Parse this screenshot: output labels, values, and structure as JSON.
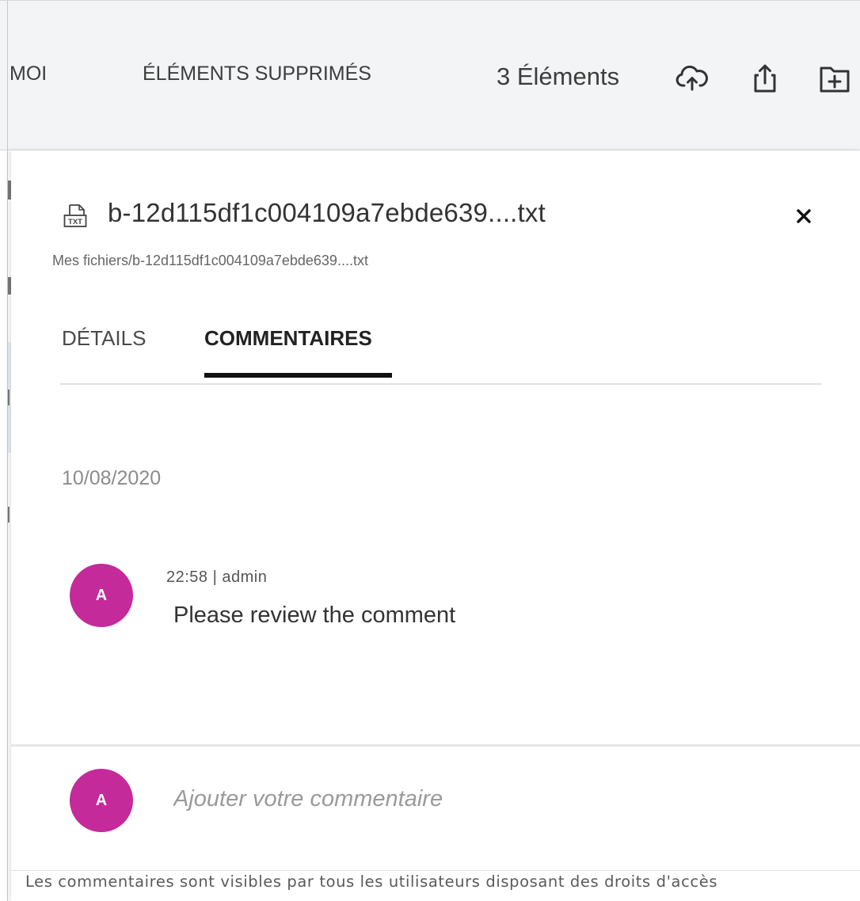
{
  "toolbar": {
    "tab_moi": "MOI",
    "tab_deleted": "ÉLÉMENTS SUPPRIMÉS",
    "item_count": "3 Éléments",
    "icons": [
      "cloud-upload-icon",
      "share-upload-icon",
      "new-folder-icon"
    ]
  },
  "panel": {
    "file_type_icon": "txt-file-icon",
    "file_type_label": "TXT",
    "file_name": "b-12d115df1c004109a7ebde639....txt",
    "file_path": "Mes fichiers/b-12d115df1c004109a7ebde639....txt",
    "tabs": [
      {
        "label": "DÉTAILS",
        "active": false
      },
      {
        "label": "COMMENTAIRES",
        "active": true
      }
    ],
    "comments": {
      "date": "10/08/2020",
      "items": [
        {
          "avatar_initial": "A",
          "meta": "22:58  |  admin",
          "text": "Please review the comment"
        }
      ]
    },
    "composer": {
      "avatar_initial": "A",
      "placeholder": "Ajouter votre commentaire"
    },
    "footer_note": "Les commentaires sont visibles par tous les utilisateurs disposant des droits d'accès"
  },
  "colors": {
    "avatar": "#c42a9a",
    "topbar_bg": "#f3f4f6",
    "active_tab_underline": "#111111"
  }
}
